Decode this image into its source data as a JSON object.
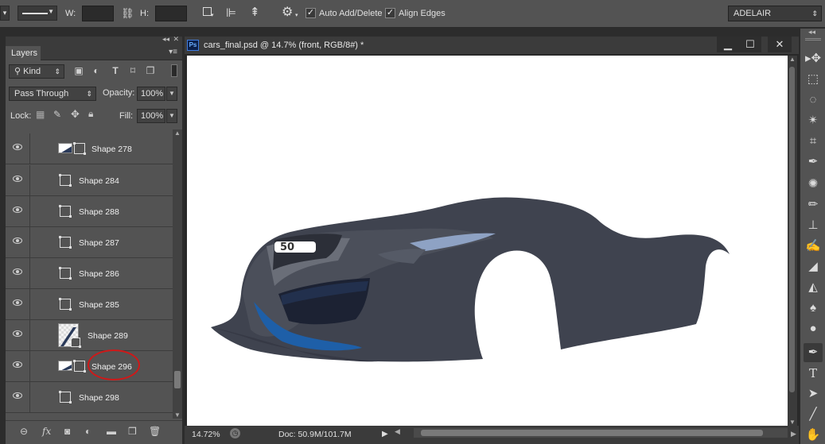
{
  "options_bar": {
    "stroke_label": "▾",
    "w_label": "W:",
    "h_label": "H:",
    "auto_add_delete": "Auto Add/Delete",
    "align_edges": "Align Edges",
    "workspace": "ADELAIR",
    "checkmark": "✓"
  },
  "layers_panel": {
    "tab": "Layers",
    "kind_filter": "Kind",
    "blend_mode": "Pass Through",
    "opacity_label": "Opacity:",
    "opacity_value": "100%",
    "lock_label": "Lock:",
    "fill_label": "Fill:",
    "fill_value": "100%",
    "layers": [
      {
        "name": "Shape 278",
        "thumb": "wide"
      },
      {
        "name": "Shape 284",
        "thumb": "none"
      },
      {
        "name": "Shape 288",
        "thumb": "none"
      },
      {
        "name": "Shape 287",
        "thumb": "none"
      },
      {
        "name": "Shape 286",
        "thumb": "none"
      },
      {
        "name": "Shape 285",
        "thumb": "none"
      },
      {
        "name": "Shape 289",
        "thumb": "tall"
      },
      {
        "name": "Shape 296",
        "thumb": "wide"
      },
      {
        "name": "Shape 298",
        "thumb": "none"
      }
    ]
  },
  "document": {
    "title": "cars_final.psd @ 14.7% (front, RGB/8#) *",
    "zoom": "14.72%",
    "doc_info": "Doc: 50.9M/101.7M",
    "ps_badge": "Ps"
  },
  "colors": {
    "car_body": "#3f434f",
    "annotation_circle": "#d01818"
  }
}
